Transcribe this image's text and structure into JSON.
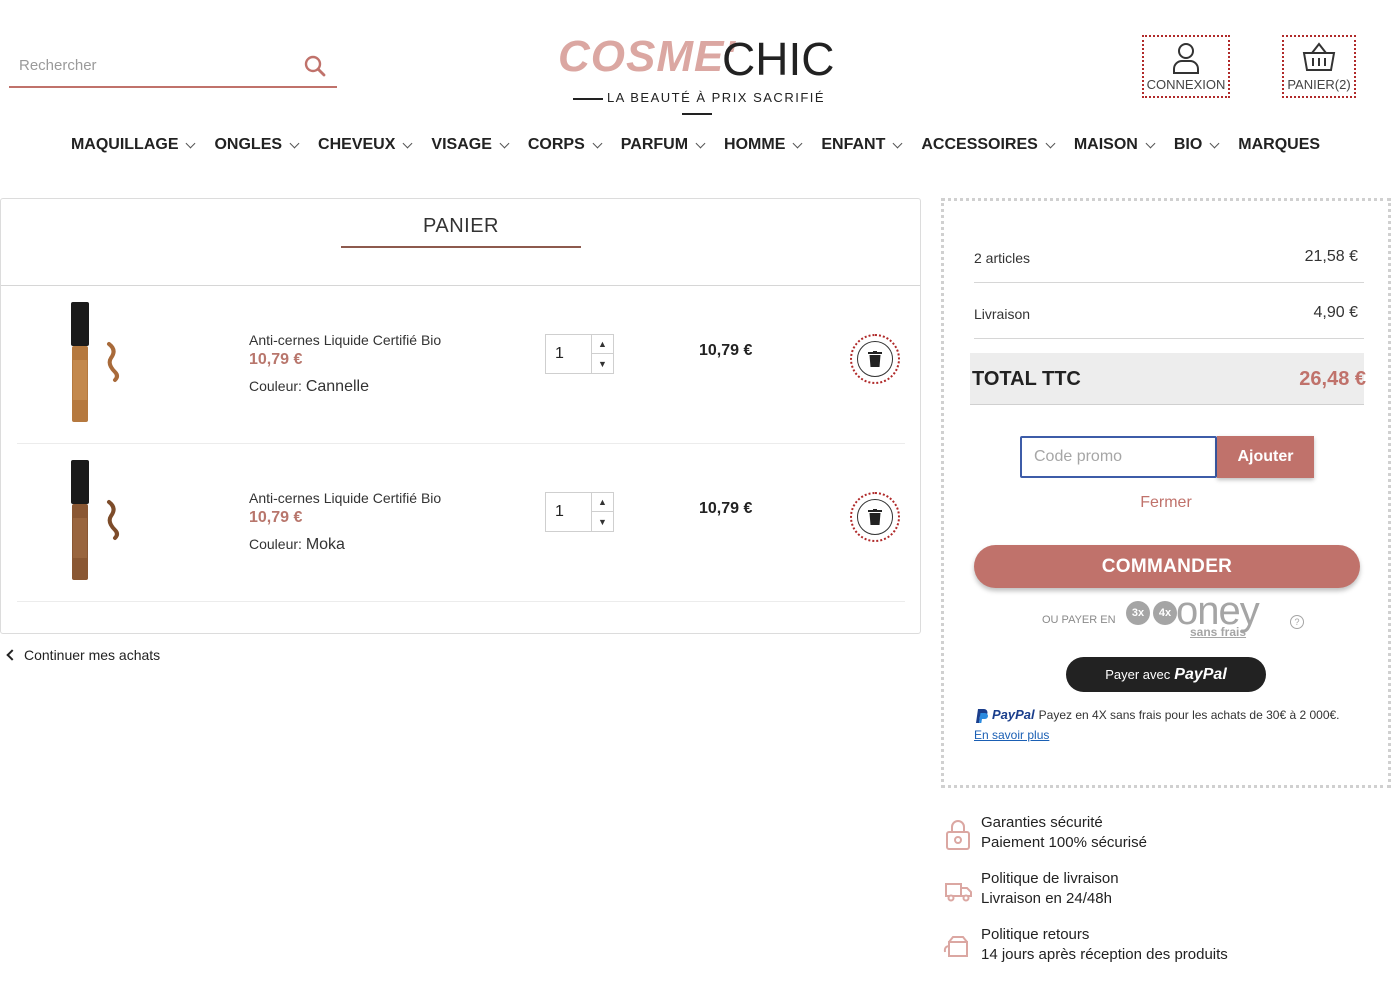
{
  "header": {
    "search_placeholder": "Rechercher",
    "logo_part1": "COSME'",
    "logo_part2": "CHIC",
    "tagline": "LA BEAUTÉ À PRIX SACRIFIÉ",
    "login_label": "CONNEXION",
    "cart_label": "PANIER(2)"
  },
  "nav": {
    "items": [
      "MAQUILLAGE",
      "ONGLES",
      "CHEVEUX",
      "VISAGE",
      "CORPS",
      "PARFUM",
      "HOMME",
      "ENFANT",
      "ACCESSOIRES",
      "MAISON",
      "BIO",
      "MARQUES"
    ]
  },
  "cart": {
    "title": "PANIER",
    "items": [
      {
        "name": "Anti-cernes Liquide Certifié Bio",
        "unit_price": "10,79 €",
        "variant_label": "Couleur:",
        "variant_value": "Cannelle",
        "quantity": "1",
        "total": "10,79 €"
      },
      {
        "name": "Anti-cernes Liquide Certifié Bio",
        "unit_price": "10,79 €",
        "variant_label": "Couleur:",
        "variant_value": "Moka",
        "quantity": "1",
        "total": "10,79 €"
      }
    ],
    "continue_label": "Continuer mes achats"
  },
  "summary": {
    "articles_label": "2 articles",
    "articles_value": "21,58 €",
    "shipping_label": "Livraison",
    "shipping_value": "4,90 €",
    "total_label": "TOTAL TTC",
    "total_value": "26,48 €",
    "promo_placeholder": "Code promo",
    "promo_button": "Ajouter",
    "close_label": "Fermer",
    "checkout_button": "COMMANDER",
    "oney_prefix": "OU PAYER EN",
    "oney_3x": "3x",
    "oney_4x": "4x",
    "oney_brand": "oney",
    "oney_sans_frais": "sans frais",
    "paypal_button_prefix": "Payer avec",
    "paypal_brand": "PayPal",
    "paypal_info": "Payez en 4X sans frais pour les achats de 30€ à 2 000€.",
    "paypal_link": "En savoir plus"
  },
  "guarantees": [
    {
      "title": "Garanties sécurité",
      "subtitle": "Paiement 100% sécurisé",
      "icon": "lock-icon"
    },
    {
      "title": "Politique de livraison",
      "subtitle": "Livraison en 24/48h",
      "icon": "truck-icon"
    },
    {
      "title": "Politique retours",
      "subtitle": "14 jours après réception des produits",
      "icon": "return-box-icon"
    }
  ],
  "colors": {
    "accent": "#c0726b",
    "logo_pink": "#dba7a2",
    "focus_blue": "#3d5ca8"
  }
}
